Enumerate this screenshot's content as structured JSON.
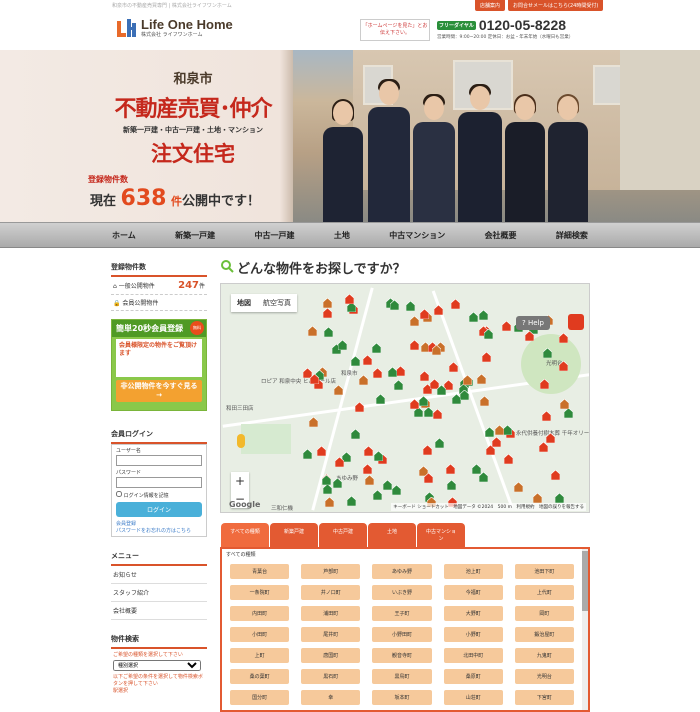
{
  "topline": "和泉市の不動産売買専門 | 株式会社ライフワンホーム",
  "toplinks": [
    "店舗案内",
    "お問合せメールはこちら(24時間受付)"
  ],
  "logo": {
    "en": "Life One Home",
    "jp": "株式会社 ライフワンホーム"
  },
  "hp_badge": "「ホームページを見た」とお伝え下さい。",
  "tel": {
    "free_dial": "フリーダイヤル",
    "number": "0120-05-8228",
    "hours": "営業時間：9:00~20:00 定休日：お盆・年末年始（水曜日も営業）"
  },
  "hero": {
    "city": "和泉市",
    "main": "不動産売買･仲介",
    "sub": "新築一戸建・中古一戸建・土地・マンション",
    "custom": "注文住宅",
    "count_label": "登録物件数",
    "count_prefix": "現在",
    "count": "638",
    "count_unit": "件",
    "count_suffix": "公開中です！"
  },
  "nav": [
    "ホーム",
    "新築一戸建",
    "中古一戸建",
    "土地",
    "中古マンション",
    "会社概要",
    "詳細検索"
  ],
  "sidebar": {
    "count_heading": "登録物件数",
    "public_label": "一般公開物件",
    "public_count": "247",
    "public_unit": "件",
    "member_label": "会員公開物件",
    "promo": {
      "top": "簡単20秒会員登録",
      "badge": "無料",
      "body": "会員様限定の物件をご覧頂けます",
      "button": "非公開物件を今すぐ見る→"
    },
    "login_heading": "会員ログイン",
    "username_label": "ユーザー名",
    "password_label": "パスワード",
    "remember_label": "ログイン情報を記憶",
    "login_button": "ログイン",
    "register_link": "会員登録",
    "forgot_link": "パスワードをお忘れの方はこちら",
    "menu_heading": "メニュー",
    "menu_items": [
      "お知らせ",
      "スタッフ紹介",
      "会社概要"
    ],
    "search_heading": "物件検索",
    "search_hint": "ご希望の種類を選択して下さい",
    "search_select": "種別選択",
    "search_hint2": "以下ご希望の条件を選択して物件検索ボタンを押して下さい",
    "search_footer": "駅選択"
  },
  "main": {
    "title": "どんな物件をお探しですか？",
    "map_tab_map": "地図",
    "map_tab_photo": "航空写真",
    "help": "Help",
    "google": "Google",
    "map_footer": "キーボード ショートカット　地図データ ©2024　500 m　利用規約　地図の誤りを報告する",
    "map_labels": [
      "ロピア 和泉中央 ヒバモール店",
      "和田三田店",
      "和泉市",
      "永代供養付樹木葬 千年オリーブの",
      "光明台",
      "あゆみ野",
      "三和仁機"
    ],
    "type_tabs": [
      "すべての種類",
      "新築戸建",
      "中古戸建",
      "土地",
      "中古マンション"
    ],
    "area_heading": "すべての種類",
    "areas": [
      "青葉台",
      "芦部町",
      "あゆみ野",
      "池上町",
      "池田下町",
      "一条院町",
      "井ノ口町",
      "いぶき野",
      "今福町",
      "上代町",
      "内田町",
      "浦田町",
      "王子町",
      "大野町",
      "岡町",
      "小田町",
      "尾井町",
      "小野田町",
      "小野町",
      "鍛治屋町",
      "上町",
      "唐国町",
      "観音寺町",
      "北田中町",
      "九鬼町",
      "桑の葉町",
      "黒石町",
      "黒鳥町",
      "桑原町",
      "光明台",
      "国分町",
      "幸",
      "坂本町",
      "山荘町",
      "下宮町"
    ]
  },
  "colors": {
    "accent": "#d9532a",
    "brand_red": "#c5281c",
    "promo_green": "#8ac84a",
    "area_cell": "#f6c99b"
  }
}
